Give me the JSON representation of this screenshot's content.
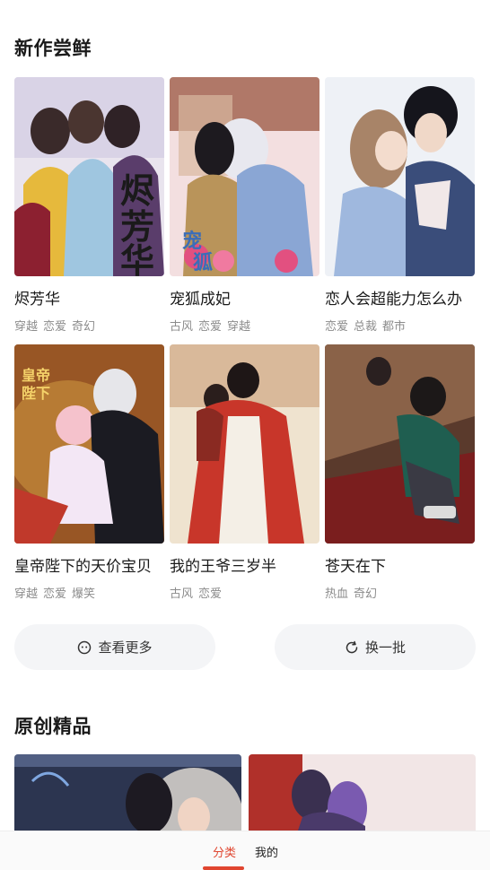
{
  "sections": {
    "new": {
      "title": "新作尝鲜",
      "books": [
        {
          "title": "烬芳华",
          "tags": [
            "穿越",
            "恋爱",
            "奇幻"
          ]
        },
        {
          "title": "宠狐成妃",
          "tags": [
            "古风",
            "恋爱",
            "穿越"
          ]
        },
        {
          "title": "恋人会超能力怎么办",
          "tags": [
            "恋爱",
            "总裁",
            "都市"
          ]
        },
        {
          "title": "皇帝陛下的天价宝贝",
          "tags": [
            "穿越",
            "恋爱",
            "爆笑"
          ]
        },
        {
          "title": "我的王爷三岁半",
          "tags": [
            "古风",
            "恋爱"
          ]
        },
        {
          "title": "苍天在下",
          "tags": [
            "热血",
            "奇幻"
          ]
        }
      ],
      "more_button": {
        "label": "查看更多",
        "icon": "smiley-icon"
      },
      "refresh_button": {
        "label": "换一批",
        "icon": "refresh-icon"
      }
    },
    "original": {
      "title": "原创精品"
    }
  },
  "tabbar": {
    "tabs": [
      {
        "label": "分类",
        "active": true
      },
      {
        "label": "我的",
        "active": false
      }
    ]
  },
  "colors": {
    "accent": "#e0452f",
    "button_bg": "#f4f5f7",
    "tag_gray": "#8c8c8c"
  }
}
